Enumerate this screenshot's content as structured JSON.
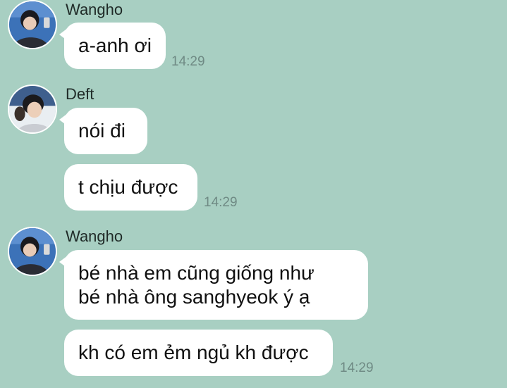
{
  "messages": [
    {
      "sender": "Wangho",
      "bubbles": [
        {
          "lines": [
            "a-anh ơi"
          ],
          "time": "14:29"
        }
      ]
    },
    {
      "sender": "Deft",
      "bubbles": [
        {
          "lines": [
            "nói đi"
          ]
        },
        {
          "lines": [
            "t chịu được"
          ],
          "time": "14:29"
        }
      ]
    },
    {
      "sender": "Wangho",
      "bubbles": [
        {
          "lines": [
            "bé nhà em cũng giống như",
            "bé nhà ông sanghyeok ý ạ"
          ]
        },
        {
          "lines": [
            "kh có em ẻm ngủ kh được"
          ],
          "time": "14:29"
        }
      ]
    }
  ],
  "colors": {
    "background": "#a8cfc2",
    "bubble": "#ffffff",
    "timestamp": "#6f8a84"
  }
}
